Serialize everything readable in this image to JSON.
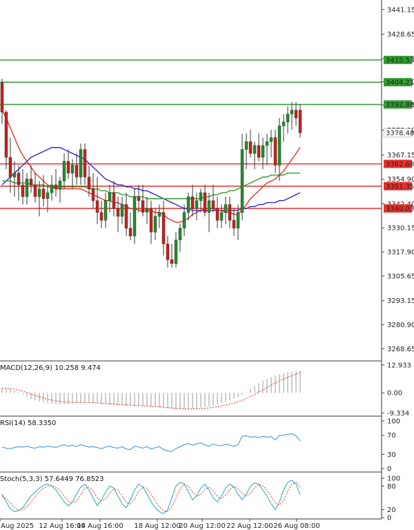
{
  "chart_data": {
    "type": "candlestick",
    "main": {
      "ylim": [
        3262.5,
        3446.0
      ],
      "y_ticks": [
        "3441.15",
        "3428.65",
        "3416.15",
        "3404.40",
        "3392.65",
        "3379.90",
        "3367.15",
        "3354.90",
        "3342.40",
        "3330.15",
        "3317.90",
        "3305.65",
        "3293.15",
        "3280.90",
        "3268.65"
      ],
      "x_ticks": [
        "Aug 2025",
        "12 Aug 16:00",
        "14 Aug 16:00",
        "18 Aug 12:00",
        "20 Aug 12:00",
        "22 Aug 12:00",
        "26 Aug 08:00"
      ],
      "levels": [
        {
          "value": 3415.53,
          "label": "3415.53",
          "color": "#2e9e2e"
        },
        {
          "value": 3404.21,
          "label": "3404.21",
          "color": "#2e9e2e"
        },
        {
          "value": 3392.88,
          "label": "3392.88",
          "color": "#2e9e2e"
        },
        {
          "value": 3362.68,
          "label": "3362.68",
          "color": "#e8302a"
        },
        {
          "value": 3351.35,
          "label": "3351.35",
          "color": "#e8302a"
        },
        {
          "value": 3340.03,
          "label": "3340.03",
          "color": "#e8302a"
        }
      ],
      "last_price": {
        "value": 3378.48,
        "label": "3378.48"
      },
      "candles": [
        [
          3404,
          3406,
          3383,
          3389
        ],
        [
          3389,
          3390,
          3360,
          3366
        ],
        [
          3366,
          3376,
          3348,
          3356
        ],
        [
          3356,
          3364,
          3346,
          3358
        ],
        [
          3358,
          3362,
          3344,
          3352
        ],
        [
          3352,
          3360,
          3342,
          3346
        ],
        [
          3346,
          3358,
          3342,
          3355
        ],
        [
          3355,
          3362,
          3348,
          3352
        ],
        [
          3352,
          3358,
          3343,
          3346
        ],
        [
          3346,
          3354,
          3336,
          3350
        ],
        [
          3350,
          3357,
          3341,
          3345
        ],
        [
          3345,
          3352,
          3338,
          3348
        ],
        [
          3348,
          3357,
          3344,
          3352
        ],
        [
          3352,
          3360,
          3346,
          3350
        ],
        [
          3350,
          3356,
          3343,
          3354
        ],
        [
          3354,
          3368,
          3350,
          3364
        ],
        [
          3364,
          3370,
          3355,
          3358
        ],
        [
          3358,
          3365,
          3350,
          3362
        ],
        [
          3362,
          3368,
          3352,
          3356
        ],
        [
          3356,
          3373,
          3352,
          3370
        ],
        [
          3370,
          3373,
          3352,
          3356
        ],
        [
          3356,
          3362,
          3346,
          3350
        ],
        [
          3350,
          3358,
          3340,
          3344
        ],
        [
          3344,
          3356,
          3332,
          3338
        ],
        [
          3338,
          3344,
          3330,
          3334
        ],
        [
          3334,
          3348,
          3330,
          3344
        ],
        [
          3344,
          3352,
          3338,
          3348
        ],
        [
          3348,
          3354,
          3336,
          3340
        ],
        [
          3340,
          3346,
          3328,
          3336
        ],
        [
          3336,
          3346,
          3332,
          3342
        ],
        [
          3342,
          3348,
          3326,
          3330
        ],
        [
          3330,
          3338,
          3324,
          3326
        ],
        [
          3326,
          3350,
          3322,
          3346
        ],
        [
          3346,
          3352,
          3338,
          3344
        ],
        [
          3344,
          3352,
          3336,
          3338
        ],
        [
          3338,
          3346,
          3332,
          3340
        ],
        [
          3340,
          3344,
          3322,
          3328
        ],
        [
          3328,
          3340,
          3324,
          3336
        ],
        [
          3336,
          3342,
          3330,
          3338
        ],
        [
          3338,
          3344,
          3316,
          3322
        ],
        [
          3322,
          3326,
          3310,
          3314
        ],
        [
          3314,
          3322,
          3310,
          3312
        ],
        [
          3312,
          3328,
          3310,
          3324
        ],
        [
          3324,
          3332,
          3318,
          3330
        ],
        [
          3330,
          3342,
          3326,
          3338
        ],
        [
          3338,
          3348,
          3334,
          3346
        ],
        [
          3346,
          3352,
          3336,
          3340
        ],
        [
          3340,
          3348,
          3334,
          3344
        ],
        [
          3344,
          3350,
          3338,
          3348
        ],
        [
          3348,
          3352,
          3336,
          3338
        ],
        [
          3338,
          3348,
          3328,
          3344
        ],
        [
          3344,
          3352,
          3338,
          3340
        ],
        [
          3340,
          3346,
          3330,
          3334
        ],
        [
          3334,
          3342,
          3330,
          3338
        ],
        [
          3338,
          3346,
          3332,
          3342
        ],
        [
          3342,
          3346,
          3330,
          3334
        ],
        [
          3334,
          3340,
          3326,
          3330
        ],
        [
          3330,
          3342,
          3324,
          3338
        ],
        [
          3338,
          3378,
          3334,
          3370
        ],
        [
          3370,
          3378,
          3360,
          3374
        ],
        [
          3374,
          3380,
          3366,
          3368
        ],
        [
          3368,
          3374,
          3360,
          3372
        ],
        [
          3372,
          3378,
          3364,
          3366
        ],
        [
          3366,
          3376,
          3360,
          3372
        ],
        [
          3372,
          3378,
          3362,
          3374
        ],
        [
          3374,
          3380,
          3366,
          3376
        ],
        [
          3376,
          3380,
          3358,
          3362
        ],
        [
          3362,
          3386,
          3354,
          3382
        ],
        [
          3382,
          3388,
          3374,
          3384
        ],
        [
          3384,
          3392,
          3378,
          3388
        ],
        [
          3388,
          3394,
          3380,
          3390
        ],
        [
          3390,
          3394,
          3382,
          3386
        ],
        [
          3390,
          3393,
          3376,
          3378.48
        ]
      ],
      "ma_red": [
        3390,
        3386,
        3381,
        3376,
        3371,
        3367,
        3364,
        3361,
        3358,
        3356,
        3354,
        3352,
        3351,
        3350,
        3350,
        3350,
        3350,
        3350,
        3350,
        3350,
        3349,
        3348,
        3347,
        3346,
        3345,
        3344,
        3344,
        3343,
        3343,
        3342,
        3341,
        3340,
        3340,
        3339,
        3339,
        3339,
        3339,
        3338,
        3338,
        3337,
        3335,
        3334,
        3333,
        3333,
        3334,
        3335,
        3337,
        3338,
        3339,
        3340,
        3340,
        3340,
        3339,
        3339,
        3338,
        3338,
        3337,
        3337,
        3339,
        3342,
        3345,
        3347,
        3349,
        3351,
        3353,
        3354,
        3355,
        3357,
        3359,
        3362,
        3365,
        3368,
        3371
      ],
      "ma_green": [
        3354,
        3354,
        3354,
        3353,
        3353,
        3353,
        3353,
        3352,
        3352,
        3352,
        3352,
        3351,
        3351,
        3351,
        3351,
        3351,
        3351,
        3351,
        3351,
        3351,
        3351,
        3350,
        3350,
        3350,
        3349,
        3349,
        3348,
        3348,
        3348,
        3347,
        3347,
        3346,
        3346,
        3346,
        3346,
        3345,
        3345,
        3345,
        3345,
        3345,
        3345,
        3345,
        3345,
        3345,
        3345,
        3345,
        3345,
        3345,
        3345,
        3346,
        3346,
        3347,
        3347,
        3348,
        3348,
        3349,
        3349,
        3350,
        3351,
        3352,
        3353,
        3354,
        3355,
        3356,
        3356,
        3357,
        3357,
        3357,
        3357,
        3358,
        3358,
        3358,
        3358
      ],
      "ma_blue": [
        3352,
        3354,
        3356,
        3358,
        3360,
        3362,
        3364,
        3366,
        3367,
        3368,
        3369,
        3370,
        3371,
        3371,
        3371,
        3370,
        3369,
        3368,
        3367,
        3366,
        3365,
        3363,
        3361,
        3359,
        3357,
        3355,
        3354,
        3353,
        3352,
        3352,
        3351,
        3351,
        3350,
        3350,
        3349,
        3349,
        3348,
        3347,
        3346,
        3345,
        3344,
        3343,
        3342,
        3341,
        3340,
        3340,
        3339,
        3339,
        3339,
        3339,
        3339,
        3339,
        3339,
        3339,
        3339,
        3339,
        3339,
        3339,
        3340,
        3340,
        3341,
        3341,
        3342,
        3342,
        3343,
        3343,
        3343,
        3344,
        3344,
        3345,
        3346,
        3347,
        3348
      ]
    },
    "macd": {
      "label": "MACD(12,26,9) 10.258 9.474",
      "y_ticks": [
        "12.933",
        "0.00",
        "-9.334"
      ],
      "ylim": [
        -10.5,
        14.5
      ],
      "hist": [
        2.5,
        2.2,
        1.8,
        1.0,
        0.3,
        -0.8,
        -1.8,
        -2.8,
        -3.5,
        -4.0,
        -4.5,
        -4.8,
        -5.0,
        -5.2,
        -5.3,
        -5.2,
        -5.0,
        -4.8,
        -4.6,
        -4.5,
        -4.5,
        -4.6,
        -4.8,
        -5.0,
        -5.2,
        -5.4,
        -5.6,
        -5.7,
        -5.8,
        -5.9,
        -6.0,
        -6.0,
        -6.0,
        -6.1,
        -6.2,
        -6.3,
        -6.5,
        -6.7,
        -6.9,
        -7.1,
        -7.3,
        -7.5,
        -7.6,
        -7.7,
        -7.7,
        -7.6,
        -7.4,
        -7.2,
        -6.9,
        -6.6,
        -6.2,
        -5.8,
        -5.3,
        -4.8,
        -4.2,
        -3.5,
        -2.8,
        -2.0,
        -1.0,
        0.3,
        1.8,
        3.2,
        4.5,
        5.6,
        6.5,
        7.3,
        8.0,
        8.6,
        9.1,
        9.5,
        9.8,
        10.0,
        10.258
      ],
      "signal": [
        2.3,
        2.2,
        2.0,
        1.7,
        1.3,
        0.8,
        0.2,
        -0.5,
        -1.2,
        -1.8,
        -2.4,
        -2.9,
        -3.3,
        -3.7,
        -4.0,
        -4.2,
        -4.4,
        -4.5,
        -4.5,
        -4.5,
        -4.5,
        -4.5,
        -4.6,
        -4.7,
        -4.8,
        -4.9,
        -5.1,
        -5.2,
        -5.4,
        -5.5,
        -5.6,
        -5.7,
        -5.8,
        -5.9,
        -6.0,
        -6.1,
        -6.2,
        -6.4,
        -6.5,
        -6.7,
        -6.9,
        -7.0,
        -7.2,
        -7.3,
        -7.4,
        -7.5,
        -7.5,
        -7.4,
        -7.3,
        -7.2,
        -7.0,
        -6.7,
        -6.4,
        -6.1,
        -5.7,
        -5.2,
        -4.7,
        -4.1,
        -3.4,
        -2.6,
        -1.7,
        -0.8,
        0.3,
        1.4,
        2.5,
        3.6,
        4.6,
        5.5,
        6.4,
        7.2,
        8.0,
        8.7,
        9.474
      ]
    },
    "rsi": {
      "label": "RSI(14) 58.3350",
      "y_ticks": [
        "100",
        "70",
        "30",
        "0"
      ],
      "ylim": [
        0,
        100
      ],
      "values": [
        45,
        43,
        42,
        44,
        46,
        45,
        47,
        44,
        43,
        46,
        45,
        47,
        46,
        44,
        48,
        50,
        47,
        49,
        46,
        50,
        48,
        45,
        46,
        44,
        42,
        45,
        47,
        44,
        43,
        46,
        41,
        40,
        47,
        45,
        43,
        46,
        41,
        44,
        46,
        40,
        37,
        36,
        42,
        46,
        50,
        53,
        49,
        52,
        54,
        50,
        47,
        52,
        49,
        48,
        51,
        49,
        47,
        50,
        68,
        69,
        66,
        67,
        65,
        68,
        66,
        67,
        60,
        70,
        70,
        72,
        73,
        69,
        58.335
      ]
    },
    "stoch": {
      "label": "Stoch(5,3,3) 57.6449 76.8523",
      "y_ticks": [
        "100",
        "80",
        "20",
        "0"
      ],
      "ylim": [
        0,
        100
      ],
      "k": [
        60,
        40,
        22,
        15,
        18,
        25,
        40,
        55,
        65,
        75,
        82,
        85,
        80,
        70,
        55,
        40,
        30,
        40,
        60,
        78,
        85,
        70,
        50,
        30,
        45,
        65,
        80,
        75,
        55,
        35,
        25,
        45,
        70,
        85,
        78,
        60,
        40,
        25,
        15,
        10,
        20,
        50,
        80,
        90,
        85,
        65,
        45,
        55,
        75,
        85,
        70,
        50,
        40,
        55,
        75,
        85,
        78,
        60,
        45,
        60,
        80,
        88,
        85,
        70,
        55,
        35,
        20,
        40,
        70,
        90,
        95,
        85,
        57.6449
      ],
      "d": [
        55,
        48,
        38,
        26,
        18,
        20,
        28,
        40,
        53,
        65,
        74,
        80,
        82,
        78,
        68,
        55,
        42,
        37,
        43,
        59,
        74,
        78,
        68,
        50,
        42,
        47,
        63,
        73,
        70,
        55,
        38,
        35,
        47,
        67,
        78,
        74,
        59,
        42,
        27,
        17,
        15,
        27,
        50,
        73,
        85,
        80,
        65,
        55,
        58,
        72,
        77,
        68,
        53,
        48,
        57,
        72,
        79,
        74,
        61,
        55,
        62,
        76,
        84,
        81,
        70,
        53,
        37,
        32,
        43,
        67,
        85,
        90,
        76.8523
      ]
    }
  }
}
